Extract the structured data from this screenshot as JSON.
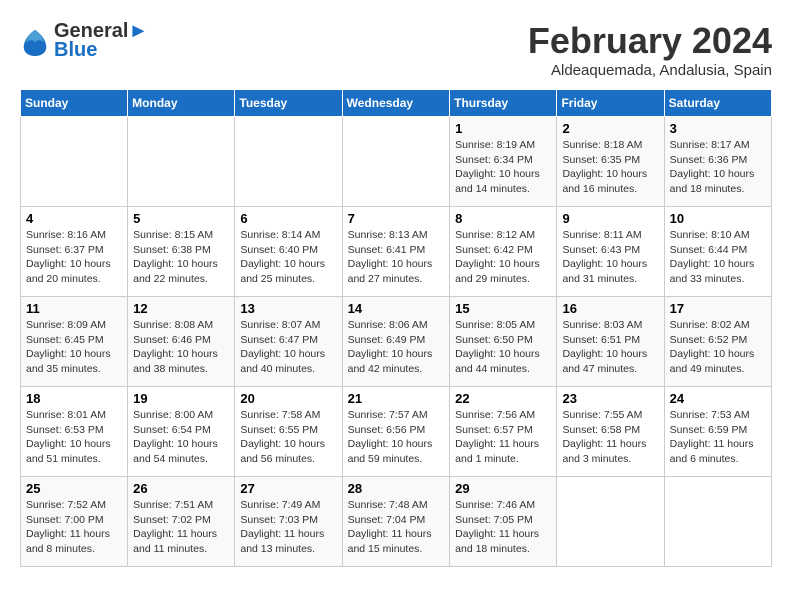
{
  "header": {
    "logo_line1": "General",
    "logo_line2": "Blue",
    "month": "February 2024",
    "location": "Aldeaquemada, Andalusia, Spain"
  },
  "days_of_week": [
    "Sunday",
    "Monday",
    "Tuesday",
    "Wednesday",
    "Thursday",
    "Friday",
    "Saturday"
  ],
  "weeks": [
    [
      {
        "day": "",
        "content": ""
      },
      {
        "day": "",
        "content": ""
      },
      {
        "day": "",
        "content": ""
      },
      {
        "day": "",
        "content": ""
      },
      {
        "day": "1",
        "content": "Sunrise: 8:19 AM\nSunset: 6:34 PM\nDaylight: 10 hours and 14 minutes."
      },
      {
        "day": "2",
        "content": "Sunrise: 8:18 AM\nSunset: 6:35 PM\nDaylight: 10 hours and 16 minutes."
      },
      {
        "day": "3",
        "content": "Sunrise: 8:17 AM\nSunset: 6:36 PM\nDaylight: 10 hours and 18 minutes."
      }
    ],
    [
      {
        "day": "4",
        "content": "Sunrise: 8:16 AM\nSunset: 6:37 PM\nDaylight: 10 hours and 20 minutes."
      },
      {
        "day": "5",
        "content": "Sunrise: 8:15 AM\nSunset: 6:38 PM\nDaylight: 10 hours and 22 minutes."
      },
      {
        "day": "6",
        "content": "Sunrise: 8:14 AM\nSunset: 6:40 PM\nDaylight: 10 hours and 25 minutes."
      },
      {
        "day": "7",
        "content": "Sunrise: 8:13 AM\nSunset: 6:41 PM\nDaylight: 10 hours and 27 minutes."
      },
      {
        "day": "8",
        "content": "Sunrise: 8:12 AM\nSunset: 6:42 PM\nDaylight: 10 hours and 29 minutes."
      },
      {
        "day": "9",
        "content": "Sunrise: 8:11 AM\nSunset: 6:43 PM\nDaylight: 10 hours and 31 minutes."
      },
      {
        "day": "10",
        "content": "Sunrise: 8:10 AM\nSunset: 6:44 PM\nDaylight: 10 hours and 33 minutes."
      }
    ],
    [
      {
        "day": "11",
        "content": "Sunrise: 8:09 AM\nSunset: 6:45 PM\nDaylight: 10 hours and 35 minutes."
      },
      {
        "day": "12",
        "content": "Sunrise: 8:08 AM\nSunset: 6:46 PM\nDaylight: 10 hours and 38 minutes."
      },
      {
        "day": "13",
        "content": "Sunrise: 8:07 AM\nSunset: 6:47 PM\nDaylight: 10 hours and 40 minutes."
      },
      {
        "day": "14",
        "content": "Sunrise: 8:06 AM\nSunset: 6:49 PM\nDaylight: 10 hours and 42 minutes."
      },
      {
        "day": "15",
        "content": "Sunrise: 8:05 AM\nSunset: 6:50 PM\nDaylight: 10 hours and 44 minutes."
      },
      {
        "day": "16",
        "content": "Sunrise: 8:03 AM\nSunset: 6:51 PM\nDaylight: 10 hours and 47 minutes."
      },
      {
        "day": "17",
        "content": "Sunrise: 8:02 AM\nSunset: 6:52 PM\nDaylight: 10 hours and 49 minutes."
      }
    ],
    [
      {
        "day": "18",
        "content": "Sunrise: 8:01 AM\nSunset: 6:53 PM\nDaylight: 10 hours and 51 minutes."
      },
      {
        "day": "19",
        "content": "Sunrise: 8:00 AM\nSunset: 6:54 PM\nDaylight: 10 hours and 54 minutes."
      },
      {
        "day": "20",
        "content": "Sunrise: 7:58 AM\nSunset: 6:55 PM\nDaylight: 10 hours and 56 minutes."
      },
      {
        "day": "21",
        "content": "Sunrise: 7:57 AM\nSunset: 6:56 PM\nDaylight: 10 hours and 59 minutes."
      },
      {
        "day": "22",
        "content": "Sunrise: 7:56 AM\nSunset: 6:57 PM\nDaylight: 11 hours and 1 minute."
      },
      {
        "day": "23",
        "content": "Sunrise: 7:55 AM\nSunset: 6:58 PM\nDaylight: 11 hours and 3 minutes."
      },
      {
        "day": "24",
        "content": "Sunrise: 7:53 AM\nSunset: 6:59 PM\nDaylight: 11 hours and 6 minutes."
      }
    ],
    [
      {
        "day": "25",
        "content": "Sunrise: 7:52 AM\nSunset: 7:00 PM\nDaylight: 11 hours and 8 minutes."
      },
      {
        "day": "26",
        "content": "Sunrise: 7:51 AM\nSunset: 7:02 PM\nDaylight: 11 hours and 11 minutes."
      },
      {
        "day": "27",
        "content": "Sunrise: 7:49 AM\nSunset: 7:03 PM\nDaylight: 11 hours and 13 minutes."
      },
      {
        "day": "28",
        "content": "Sunrise: 7:48 AM\nSunset: 7:04 PM\nDaylight: 11 hours and 15 minutes."
      },
      {
        "day": "29",
        "content": "Sunrise: 7:46 AM\nSunset: 7:05 PM\nDaylight: 11 hours and 18 minutes."
      },
      {
        "day": "",
        "content": ""
      },
      {
        "day": "",
        "content": ""
      }
    ]
  ]
}
